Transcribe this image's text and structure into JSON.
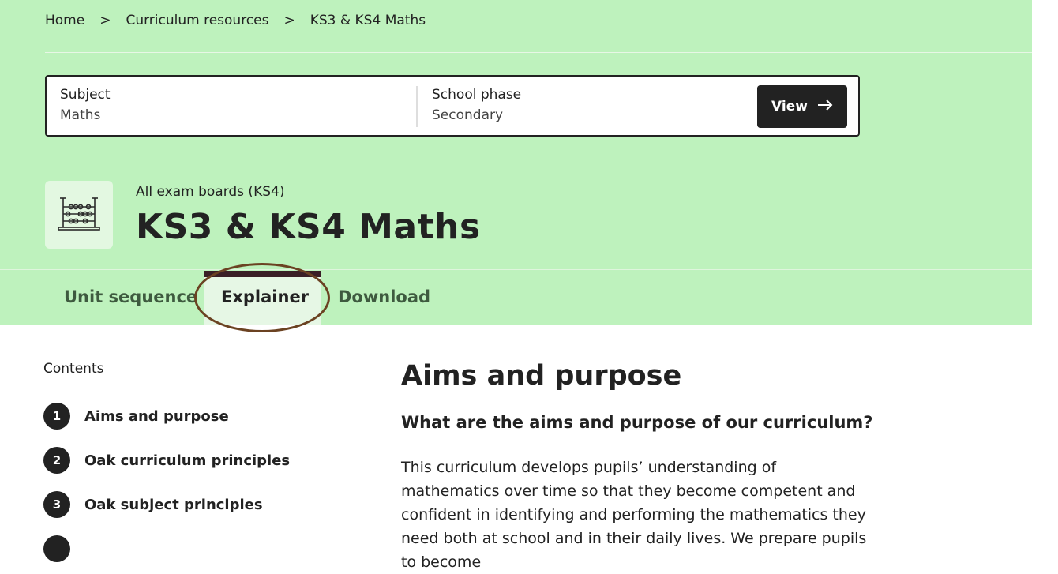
{
  "breadcrumb": {
    "items": [
      "Home",
      "Curriculum resources",
      "KS3 & KS4 Maths"
    ],
    "separator": ">"
  },
  "selector": {
    "subject_label": "Subject",
    "subject_value": "Maths",
    "phase_label": "School phase",
    "phase_value": "Secondary",
    "view_label": "View",
    "view_icon": "arrow-right-icon"
  },
  "header": {
    "icon": "abacus-icon",
    "subtitle": "All exam boards (KS4)",
    "title": "KS3 & KS4 Maths"
  },
  "tabs": [
    {
      "label": "Unit sequence",
      "active": false
    },
    {
      "label": "Explainer",
      "active": true
    },
    {
      "label": "Download",
      "active": false
    }
  ],
  "contents": {
    "label": "Contents",
    "items": [
      {
        "num": "1",
        "label": "Aims and purpose"
      },
      {
        "num": "2",
        "label": "Oak curriculum principles"
      },
      {
        "num": "3",
        "label": "Oak subject principles"
      }
    ]
  },
  "main": {
    "heading": "Aims and purpose",
    "subheading": "What are the aims and purpose of our curriculum?",
    "paragraph": "This curriculum develops pupils’ understanding of mathematics over time so that they become competent and confident in identifying and performing the mathematics they need both at school and in their daily lives. We prepare pupils to become"
  },
  "colors": {
    "hero_bg": "#bef2bd",
    "dark": "#222222",
    "annotation_circle": "#6b4222"
  }
}
